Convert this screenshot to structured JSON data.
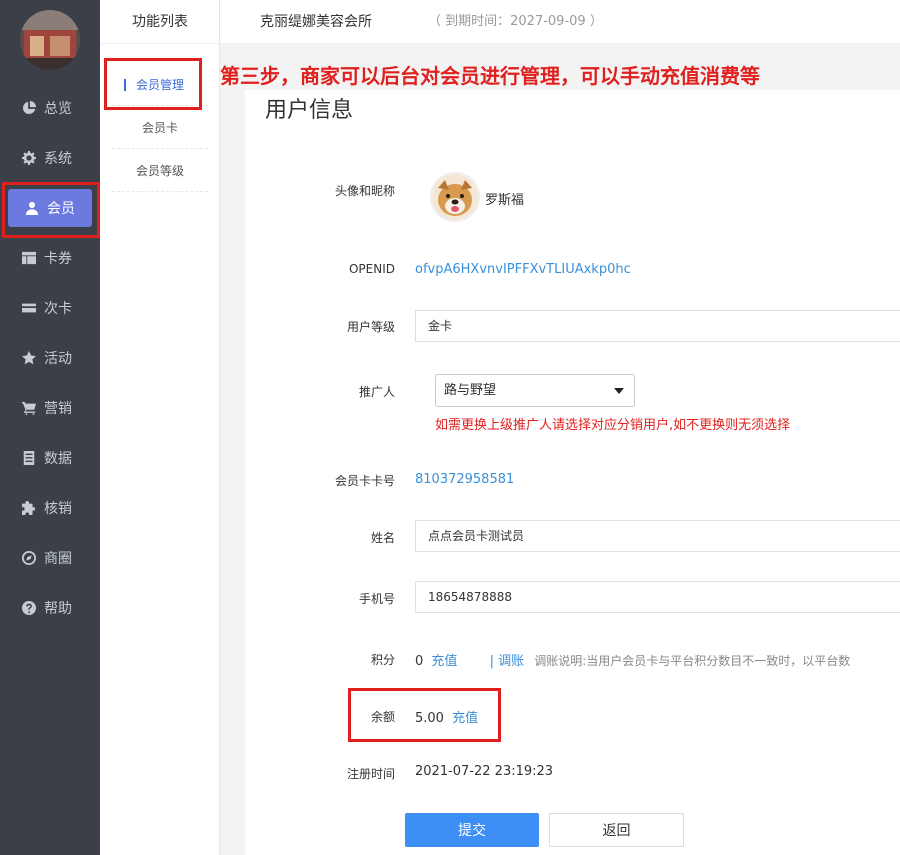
{
  "sidebar": {
    "items": [
      {
        "label": "总览",
        "icon": "pie-chart-icon"
      },
      {
        "label": "系统",
        "icon": "gear-icon"
      },
      {
        "label": "会员",
        "icon": "user-icon"
      },
      {
        "label": "卡券",
        "icon": "table-icon"
      },
      {
        "label": "次卡",
        "icon": "card-icon"
      },
      {
        "label": "活动",
        "icon": "star-icon"
      },
      {
        "label": "营销",
        "icon": "cart-icon"
      },
      {
        "label": "数据",
        "icon": "list-icon"
      },
      {
        "label": "核销",
        "icon": "puzzle-icon"
      },
      {
        "label": "商圈",
        "icon": "compass-icon"
      },
      {
        "label": "帮助",
        "icon": "question-icon"
      }
    ],
    "active_index": 2,
    "active_color": "#6c7ae0"
  },
  "subnav": {
    "title": "功能列表",
    "items": [
      "会员管理",
      "会员卡",
      "会员等级"
    ]
  },
  "header": {
    "shop_name": "克丽缇娜美容会所",
    "expire": "（ 到期时间：2027-09-09 ）"
  },
  "annotation": "第三步，商家可以后台对会员进行管理，可以手动充值消费等",
  "main": {
    "title": "用户信息",
    "fields": {
      "avatar_label": "头像和昵称",
      "nickname": "罗斯福",
      "openid_label": "OPENID",
      "openid": "ofvpA6HXvnvIPFFXvTLIUAxkp0hc",
      "level_label": "用户等级",
      "level": "金卡",
      "promoter_label": "推广人",
      "promoter": "路与野望",
      "promoter_hint": "如需更换上级推广人请选择对应分销用户,如不更换则无须选择",
      "card_no_label": "会员卡卡号",
      "card_no": "810372958581",
      "name_label": "姓名",
      "name": "点点会员卡测试员",
      "phone_label": "手机号",
      "phone": "18654878888",
      "points_label": "积分",
      "points": "0",
      "points_recharge": "充值",
      "points_adjust": "| 调账",
      "points_note": "调账说明:当用户会员卡与平台积分数目不一致时，以平台数",
      "balance_label": "余额",
      "balance": "5.00",
      "balance_recharge": "充值",
      "reg_time_label": "注册时间",
      "reg_time": "2021-07-22 23:19:23"
    },
    "submit": "提交",
    "back": "返回"
  },
  "colors": {
    "highlight_red": "#e0201e",
    "link_blue": "#3b8fd9",
    "submit_blue": "#3d8ef5"
  }
}
